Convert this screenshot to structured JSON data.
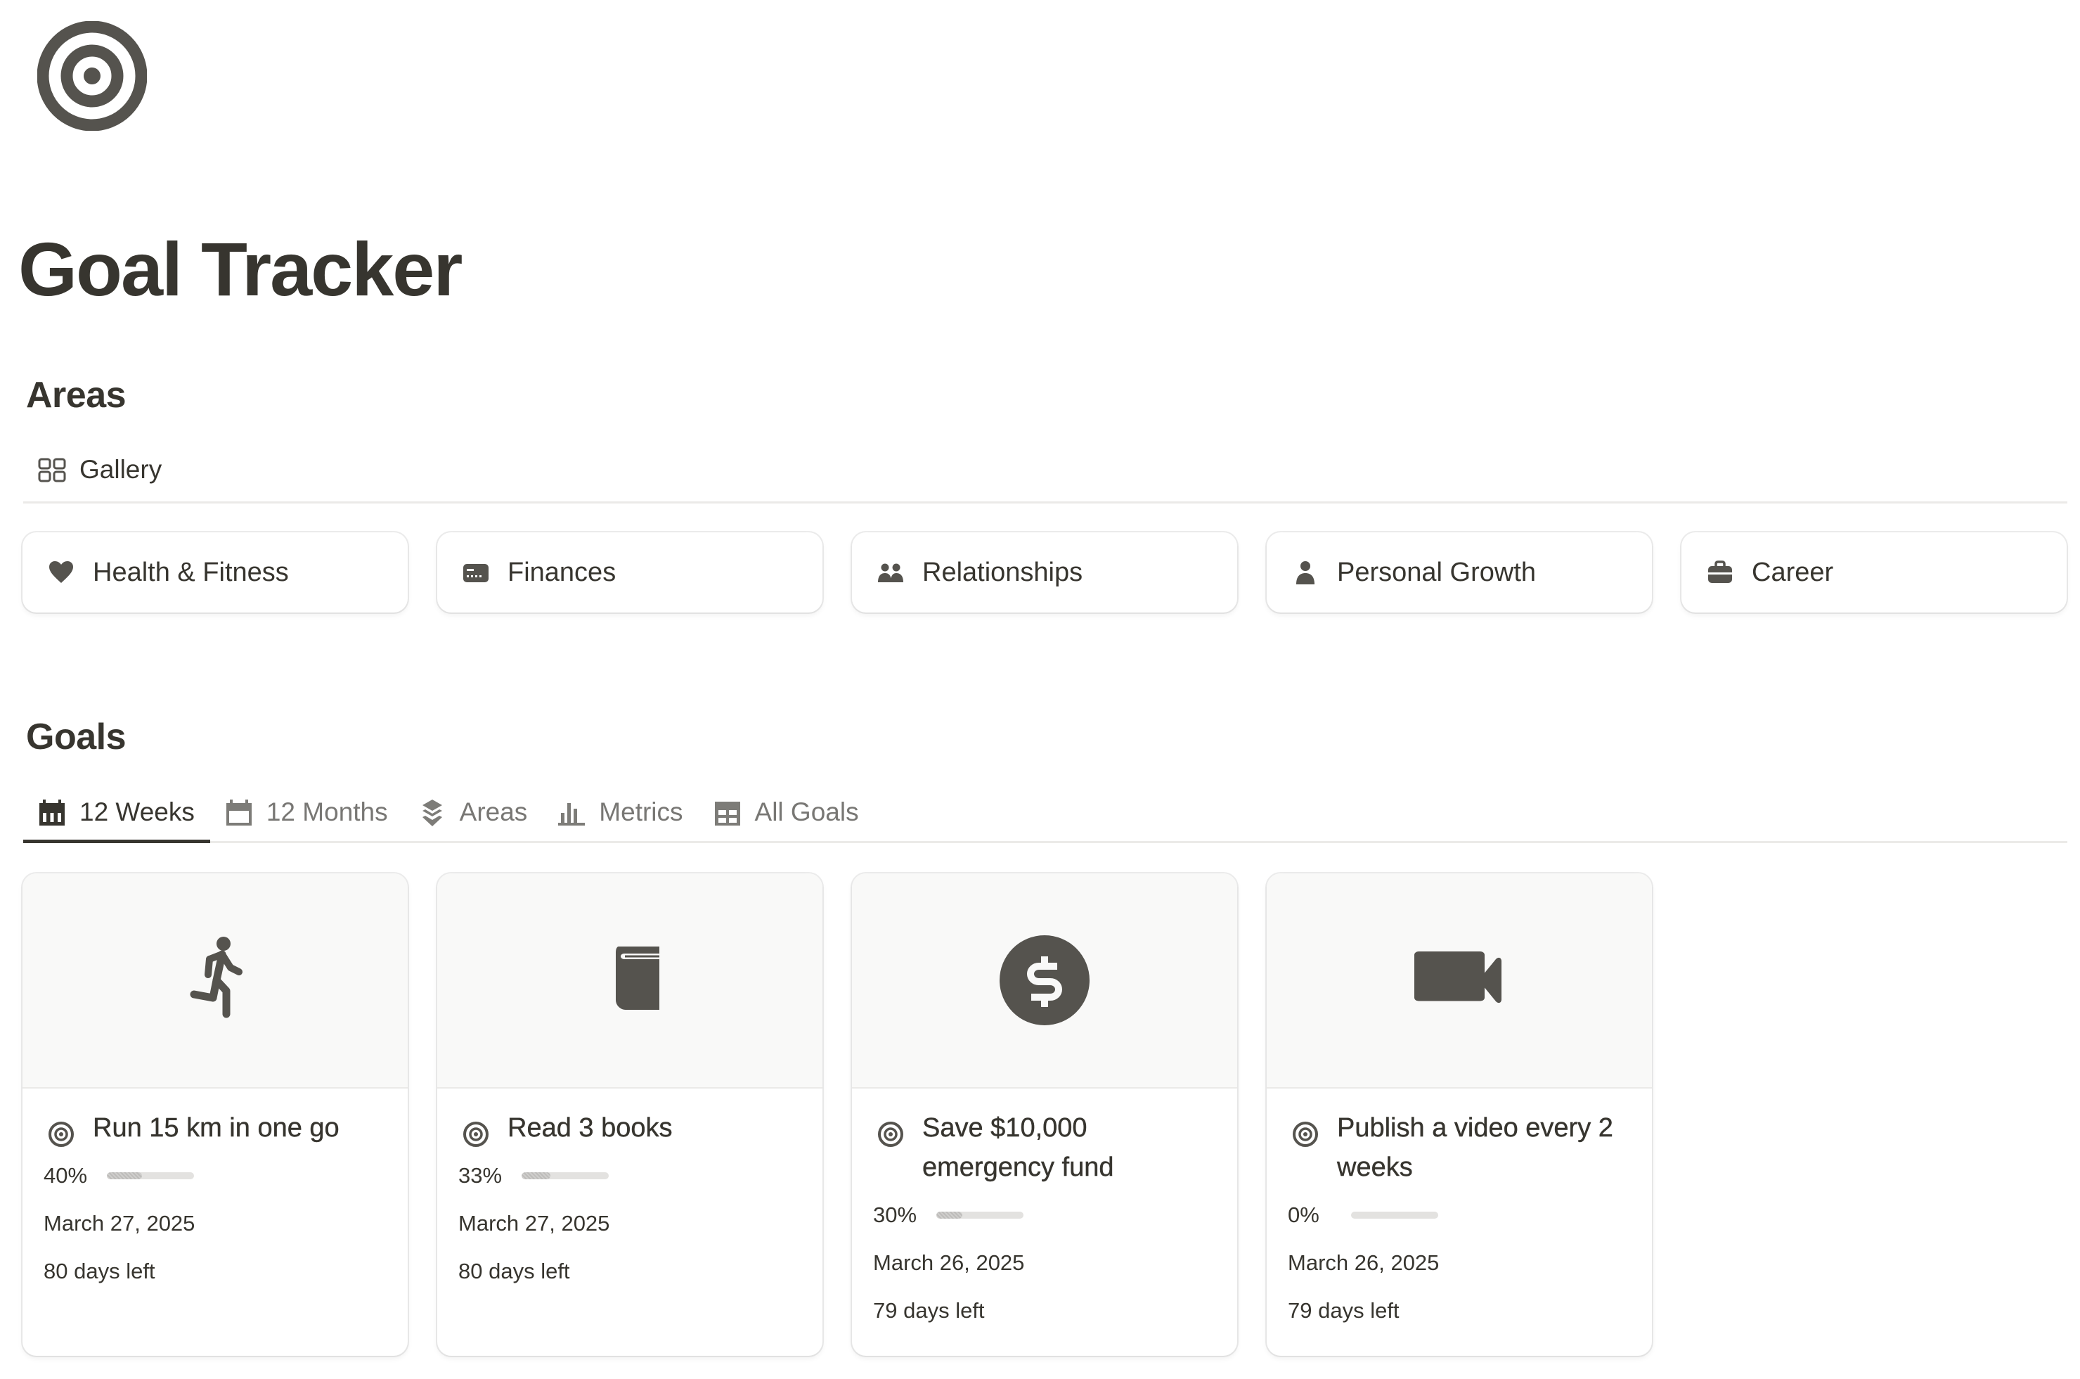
{
  "page": {
    "icon": "target-icon",
    "title": "Goal Tracker"
  },
  "areas": {
    "heading": "Areas",
    "views": [
      {
        "label": "Gallery",
        "icon": "gallery-grid-icon",
        "active": true
      }
    ],
    "items": [
      {
        "label": "Health & Fitness",
        "icon": "heart-icon"
      },
      {
        "label": "Finances",
        "icon": "credit-card-icon"
      },
      {
        "label": "Relationships",
        "icon": "people-icon"
      },
      {
        "label": "Personal Growth",
        "icon": "person-icon"
      },
      {
        "label": "Career",
        "icon": "briefcase-icon"
      }
    ]
  },
  "goals": {
    "heading": "Goals",
    "views": [
      {
        "label": "12 Weeks",
        "icon": "calendar-week-icon",
        "active": true
      },
      {
        "label": "12 Months",
        "icon": "calendar-icon",
        "active": false
      },
      {
        "label": "Areas",
        "icon": "layers-icon",
        "active": false
      },
      {
        "label": "Metrics",
        "icon": "bar-chart-icon",
        "active": false
      },
      {
        "label": "All Goals",
        "icon": "table-icon",
        "active": false
      }
    ],
    "items": [
      {
        "title": "Run 15 km in one go",
        "cover_icon": "runner-icon",
        "progress_label": "40%",
        "progress": 0.4,
        "date": "March 27, 2025",
        "days_left": "80 days left"
      },
      {
        "title": "Read 3 books",
        "cover_icon": "book-icon",
        "progress_label": "33%",
        "progress": 0.33,
        "date": "March 27, 2025",
        "days_left": "80 days left"
      },
      {
        "title": "Save $10,000 emergency fund",
        "cover_icon": "dollar-coin-icon",
        "progress_label": "30%",
        "progress": 0.3,
        "date": "March 26, 2025",
        "days_left": "79 days left"
      },
      {
        "title": "Publish a video every 2 weeks",
        "cover_icon": "video-camera-icon",
        "progress_label": "0%",
        "progress": 0.0,
        "date": "March 26, 2025",
        "days_left": "79 days left"
      }
    ]
  },
  "colors": {
    "text": "#37352f",
    "muted_text": "#787774",
    "icon": "#55534e",
    "cover_bg": "#f9f9f8",
    "divider": "#ebeae8",
    "progress_track": "#e3e2e0",
    "progress_fill": "#c4c3c1"
  }
}
